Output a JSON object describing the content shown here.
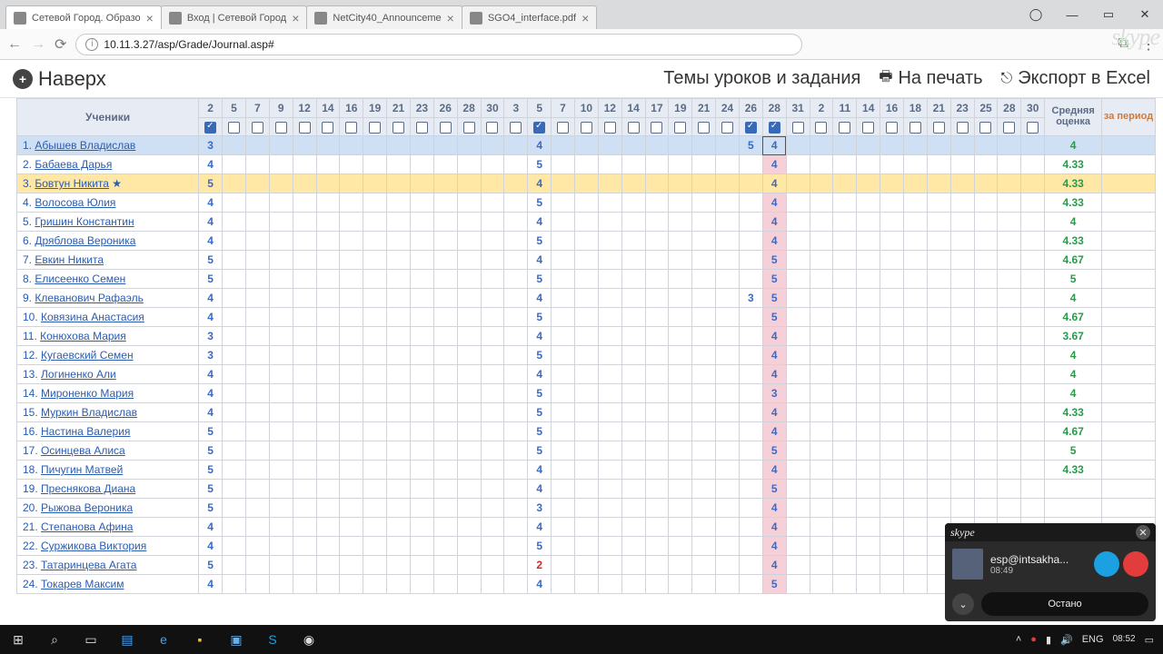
{
  "browser": {
    "tabs": [
      {
        "title": "Сетевой Город. Образо",
        "active": true
      },
      {
        "title": "Вход | Сетевой Город",
        "active": false
      },
      {
        "title": "NetCity40_Announceme",
        "active": false
      },
      {
        "title": "SGO4_interface.pdf",
        "active": false
      }
    ],
    "url": "10.11.3.27/asp/Grade/Journal.asp#",
    "win": {
      "min": "—",
      "max": "▭",
      "close": "✕",
      "user": "◯"
    }
  },
  "toolbar": {
    "up": "Наверх",
    "tasks": "Темы уроков и задания",
    "print": "На печать",
    "export": "Экспорт в Excel"
  },
  "headers": {
    "students": "Ученики",
    "avg": "Средняя оценка",
    "period": "за период"
  },
  "days": [
    "2",
    "5",
    "7",
    "9",
    "12",
    "14",
    "16",
    "19",
    "21",
    "23",
    "26",
    "28",
    "30",
    "3",
    "5",
    "7",
    "10",
    "12",
    "14",
    "17",
    "19",
    "21",
    "24",
    "26",
    "28",
    "31",
    "2",
    "11",
    "14",
    "16",
    "18",
    "21",
    "23",
    "25",
    "28",
    "30"
  ],
  "checked": [
    0,
    14,
    23,
    24
  ],
  "pinkCol": 24,
  "cursorRow": 0,
  "students": [
    {
      "n": "1",
      "name": "Абышев Владислав",
      "g": {
        "0": "3",
        "14": "4",
        "23": "5",
        "24": "4"
      },
      "avg": "4",
      "sel": true
    },
    {
      "n": "2",
      "name": "Бабаева Дарья",
      "g": {
        "0": "4",
        "14": "5",
        "24": "4"
      },
      "avg": "4.33"
    },
    {
      "n": "3",
      "name": "Бовтун Никита",
      "star": true,
      "g": {
        "0": "5",
        "14": "4",
        "24": "4"
      },
      "avg": "4.33",
      "hl": true
    },
    {
      "n": "4",
      "name": "Волосова Юлия",
      "g": {
        "0": "4",
        "14": "5",
        "24": "4"
      },
      "avg": "4.33"
    },
    {
      "n": "5",
      "name": "Гришин Константин",
      "g": {
        "0": "4",
        "14": "4",
        "24": "4"
      },
      "avg": "4"
    },
    {
      "n": "6",
      "name": "Дряблова Вероника",
      "g": {
        "0": "4",
        "14": "5",
        "24": "4"
      },
      "avg": "4.33"
    },
    {
      "n": "7",
      "name": "Евкин Никита",
      "g": {
        "0": "5",
        "14": "4",
        "24": "5"
      },
      "avg": "4.67"
    },
    {
      "n": "8",
      "name": "Елисеенко Семен",
      "g": {
        "0": "5",
        "14": "5",
        "24": "5"
      },
      "avg": "5"
    },
    {
      "n": "9",
      "name": "Клеванович Рафаэль",
      "g": {
        "0": "4",
        "14": "4",
        "23": "3",
        "24": "5"
      },
      "avg": "4"
    },
    {
      "n": "10",
      "name": "Ковязина Анастасия",
      "g": {
        "0": "4",
        "14": "5",
        "24": "5"
      },
      "avg": "4.67"
    },
    {
      "n": "11",
      "name": "Конюхова Мария",
      "g": {
        "0": "3",
        "14": "4",
        "24": "4"
      },
      "avg": "3.67"
    },
    {
      "n": "12",
      "name": "Кугаевский Семен",
      "g": {
        "0": "3",
        "14": "5",
        "24": "4"
      },
      "avg": "4"
    },
    {
      "n": "13",
      "name": "Логиненко Али",
      "g": {
        "0": "4",
        "14": "4",
        "24": "4"
      },
      "avg": "4"
    },
    {
      "n": "14",
      "name": "Мироненко Мария",
      "g": {
        "0": "4",
        "14": "5",
        "24": "3"
      },
      "avg": "4"
    },
    {
      "n": "15",
      "name": "Муркин Владислав",
      "g": {
        "0": "4",
        "14": "5",
        "24": "4"
      },
      "avg": "4.33"
    },
    {
      "n": "16",
      "name": "Настина Валерия",
      "g": {
        "0": "5",
        "14": "5",
        "24": "4"
      },
      "avg": "4.67"
    },
    {
      "n": "17",
      "name": "Осинцева Алиса",
      "g": {
        "0": "5",
        "14": "5",
        "24": "5"
      },
      "avg": "5"
    },
    {
      "n": "18",
      "name": "Пичугин Матвей",
      "g": {
        "0": "5",
        "14": "4",
        "24": "4"
      },
      "avg": "4.33"
    },
    {
      "n": "19",
      "name": "Преснякова Диана",
      "g": {
        "0": "5",
        "14": "4",
        "24": "5"
      },
      "avg": ""
    },
    {
      "n": "20",
      "name": "Рыжова Вероника",
      "g": {
        "0": "5",
        "14": "3",
        "24": "4"
      },
      "avg": ""
    },
    {
      "n": "21",
      "name": "Степанова Афина",
      "g": {
        "0": "4",
        "14": "4",
        "24": "4"
      },
      "avg": ""
    },
    {
      "n": "22",
      "name": "Суржикова Виктория",
      "g": {
        "0": "4",
        "14": "5",
        "24": "4"
      },
      "avg": ""
    },
    {
      "n": "23",
      "name": "Татаринцева Агата",
      "g": {
        "0": "5",
        "14": "2",
        "24": "4"
      },
      "avg": ""
    },
    {
      "n": "24",
      "name": "Токарев Максим",
      "g": {
        "0": "4",
        "14": "4",
        "24": "5"
      },
      "avg": ""
    }
  ],
  "skype": {
    "logo": "skype",
    "user": "esp@intsakha...",
    "time": "08:49",
    "stop": "Остано"
  },
  "taskbar": {
    "lang": "ENG",
    "time": "08:52"
  }
}
